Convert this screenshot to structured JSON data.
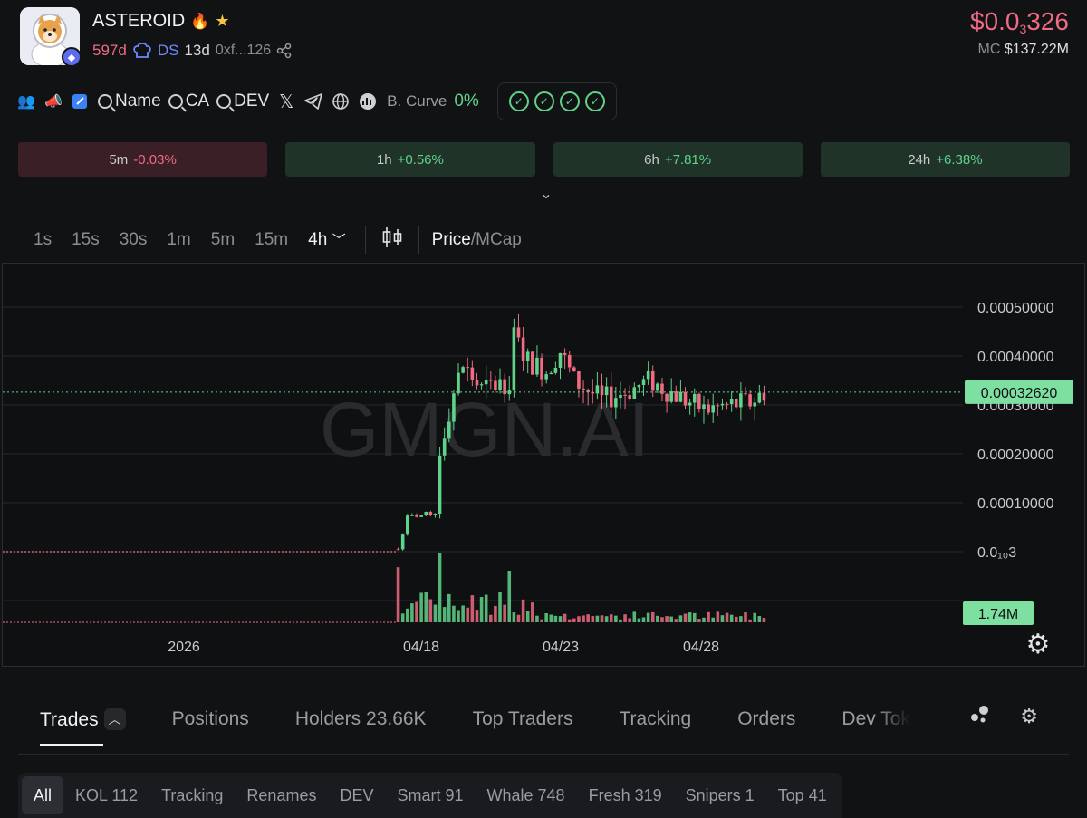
{
  "token": {
    "name": "ASTEROID",
    "age": "597d",
    "ds_label": "DS",
    "ds_age": "13d",
    "address": "0xf...126"
  },
  "price": {
    "prefix": "$0.0",
    "sub": "3",
    "digits": "326",
    "mc_label": "MC",
    "mc_value": "$137.22M"
  },
  "info_row": {
    "search_name": "Name",
    "search_ca": "CA",
    "search_dev": "DEV",
    "bcurve_label": "B. Curve",
    "bcurve_value": "0%"
  },
  "changes": [
    {
      "period": "5m",
      "value": "-0.03%",
      "direction": "down"
    },
    {
      "period": "1h",
      "value": "+0.56%",
      "direction": "up"
    },
    {
      "period": "6h",
      "value": "+7.81%",
      "direction": "up"
    },
    {
      "period": "24h",
      "value": "+6.38%",
      "direction": "up"
    }
  ],
  "intervals": [
    "1s",
    "15s",
    "30s",
    "1m",
    "5m",
    "15m"
  ],
  "active_interval": "4h",
  "price_toggle": {
    "price": "Price",
    "mcap": "/MCap"
  },
  "chart_data": {
    "type": "candlestick",
    "watermark": "GMGN.AI",
    "y_ticks": [
      "0.00050000",
      "0.00040000",
      "0.00030000",
      "0.00020000",
      "0.00010000",
      "0.0₁₀3"
    ],
    "x_ticks": [
      "2026",
      "04/18",
      "04/23",
      "04/28"
    ],
    "current_price_label": "0.00032620",
    "current_price": 0.0003262,
    "volume_label": "1.74M",
    "ylim": [
      0,
      0.0005
    ]
  },
  "tabs": [
    {
      "label": "Trades",
      "active": true
    },
    {
      "label": "Positions"
    },
    {
      "label": "Holders 23.66K"
    },
    {
      "label": "Top Traders"
    },
    {
      "label": "Tracking"
    },
    {
      "label": "Orders"
    },
    {
      "label": "Dev Tok"
    }
  ],
  "filters": [
    {
      "label": "All",
      "active": true
    },
    {
      "label": "KOL 112"
    },
    {
      "label": "Tracking"
    },
    {
      "label": "Renames"
    },
    {
      "label": "DEV"
    },
    {
      "label": "Smart 91"
    },
    {
      "label": "Whale 748"
    },
    {
      "label": "Fresh 319"
    },
    {
      "label": "Snipers 1"
    },
    {
      "label": "Top 41"
    }
  ],
  "colors": {
    "up": "#5fd38a",
    "down": "#f06a82",
    "bg": "#111214"
  }
}
